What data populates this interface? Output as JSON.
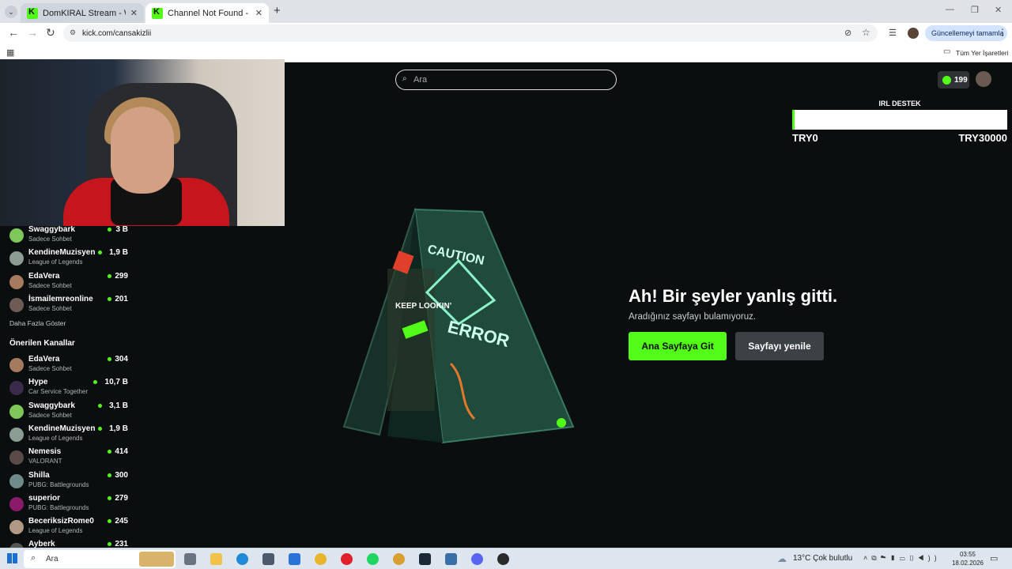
{
  "browser": {
    "tabs": [
      {
        "title": "DomKIRAL Stream - Watch Live",
        "close": "✕"
      },
      {
        "title": "Channel Not Found - Kick Strea",
        "close": "✕"
      }
    ],
    "new_tab": "+",
    "url": "kick.com/cansakizlii",
    "update_button": "Güncellemeyi tamamla",
    "bookmarks_folder": "Tüm Yer İşaretleri"
  },
  "header": {
    "search_placeholder": "Ara",
    "coins": "199"
  },
  "goal": {
    "title": "IRL DESTEK",
    "min_label": "TRY0",
    "max_label": "TRY30000",
    "progress": 0
  },
  "sidebar": {
    "followed": [
      {
        "name": "Swaggybark",
        "category": "Sadece Sohbet",
        "viewers": "3 B",
        "avatar": "#7ec85a"
      },
      {
        "name": "KendineMuzisyen",
        "category": "League of Legends",
        "viewers": "1,9 B",
        "avatar": "#8a9c94"
      },
      {
        "name": "EdaVera",
        "category": "Sadece Sohbet",
        "viewers": "299",
        "avatar": "#a57a5e"
      },
      {
        "name": "İsmailemreonline",
        "category": "Sadece Sohbet",
        "viewers": "201",
        "avatar": "#6e5b55"
      }
    ],
    "show_more": "Daha Fazla Göster",
    "recommended_header": "Önerilen Kanallar",
    "recommended": [
      {
        "name": "EdaVera",
        "category": "Sadece Sohbet",
        "viewers": "304",
        "avatar": "#a57a5e"
      },
      {
        "name": "Hype",
        "category": "Car Service Together",
        "viewers": "10,7 B",
        "avatar": "#3b2a4a"
      },
      {
        "name": "Swaggybark",
        "category": "Sadece Sohbet",
        "viewers": "3,1 B",
        "avatar": "#7ec85a"
      },
      {
        "name": "KendineMuzisyen",
        "category": "League of Legends",
        "viewers": "1,9 B",
        "avatar": "#8a9c94"
      },
      {
        "name": "Nemesis",
        "category": "VALORANT",
        "viewers": "414",
        "avatar": "#5a4b48"
      },
      {
        "name": "Shilla",
        "category": "PUBG: Battlegrounds",
        "viewers": "300",
        "avatar": "#6f8a8a"
      },
      {
        "name": "superior",
        "category": "PUBG: Battlegrounds",
        "viewers": "279",
        "avatar": "#8a1a6a"
      },
      {
        "name": "BeceriksizRome0",
        "category": "League of Legends",
        "viewers": "245",
        "avatar": "#b09a86"
      },
      {
        "name": "Ayberk",
        "category": "",
        "viewers": "231",
        "avatar": "#555"
      }
    ]
  },
  "error": {
    "title": "Ah! Bir şeyler yanlış gitti.",
    "subtitle": "Aradığınız sayfayı bulamıyoruz.",
    "home_button": "Ana Sayfaya Git",
    "reload_button": "Sayfayı yenile",
    "sign_caution": "CAUTION",
    "sign_error": "ERROR",
    "sign_keep": "KEEP LOOKIN'"
  },
  "taskbar": {
    "search": "Ara",
    "weather": "13°C  Çok bulutlu",
    "time": "03:55",
    "date": "18.02.2026"
  },
  "colors": {
    "accent": "#53fc18",
    "page_bg": "#0b0e0f"
  }
}
